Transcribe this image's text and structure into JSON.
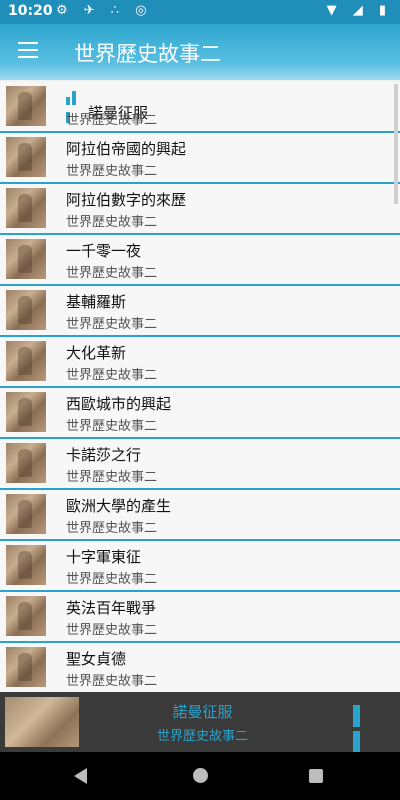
{
  "status_bar": {
    "time": "10:20"
  },
  "app_bar": {
    "title": "世界歷史故事二"
  },
  "list": {
    "items": [
      {
        "title": "諾曼征服",
        "subtitle": "世界歷史故事二",
        "playing": true
      },
      {
        "title": "阿拉伯帝國的興起",
        "subtitle": "世界歷史故事二"
      },
      {
        "title": "阿拉伯數字的來歷",
        "subtitle": "世界歷史故事二"
      },
      {
        "title": "一千零一夜",
        "subtitle": "世界歷史故事二"
      },
      {
        "title": "基輔羅斯",
        "subtitle": "世界歷史故事二"
      },
      {
        "title": "大化革新",
        "subtitle": "世界歷史故事二"
      },
      {
        "title": "西歐城市的興起",
        "subtitle": "世界歷史故事二"
      },
      {
        "title": "卡諾莎之行",
        "subtitle": "世界歷史故事二"
      },
      {
        "title": "歐洲大學的產生",
        "subtitle": "世界歷史故事二"
      },
      {
        "title": "十字軍東征",
        "subtitle": "世界歷史故事二"
      },
      {
        "title": "英法百年戰爭",
        "subtitle": "世界歷史故事二"
      },
      {
        "title": "聖女貞德",
        "subtitle": "世界歷史故事二"
      }
    ]
  },
  "player": {
    "title": "諾曼征服",
    "subtitle": "世界歷史故事二"
  },
  "colors": {
    "accent": "#2aa3cc",
    "status_bar": "#1f8fb9",
    "player_bg": "#3a3a3a"
  },
  "icons": [
    "menu-icon",
    "equalizer-icon",
    "pause-icon",
    "nav-back-icon",
    "nav-home-icon",
    "nav-recent-icon"
  ]
}
